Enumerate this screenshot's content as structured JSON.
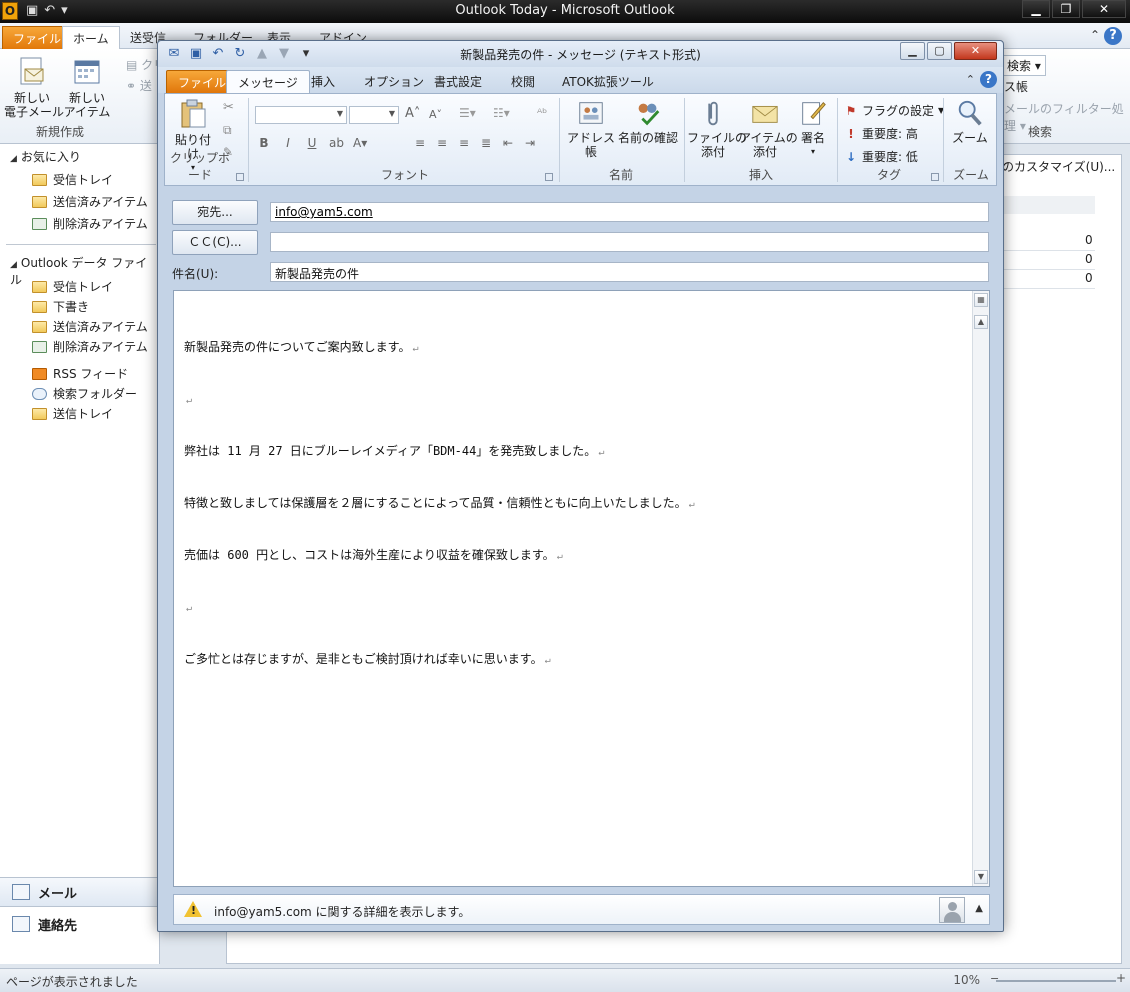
{
  "outlook": {
    "title": "Outlook Today - Microsoft Outlook",
    "app_icon_letter": "O",
    "tabs": [
      "ファイル",
      "ホーム",
      "送受信",
      "フォルダー",
      "表示",
      "アドイン"
    ],
    "ribbon": {
      "new_mail": "新しい\n電子メール",
      "new_items": "新しい\nアイテム",
      "group_new": "新規作成",
      "search_box": "検索",
      "address_book": "ス帳",
      "filter_mail": "メールのフィルター処理",
      "group_search": "検索"
    },
    "nav": {
      "favorites_header": "お気に入り",
      "favorites": [
        "受信トレイ",
        "送信済みアイテム",
        "削除済みアイテム"
      ],
      "data_file_header": "Outlook データ ファイル",
      "data_file_items": [
        "受信トレイ",
        "下書き",
        "送信済みアイテム",
        "削除済みアイテム",
        "RSS フィード",
        "検索フォルダー",
        "送信トレイ"
      ],
      "mail": "メール",
      "contacts": "連絡先"
    },
    "content": {
      "customize_link": "のカスタマイズ(U)...",
      "counts": [
        "0",
        "0",
        "0"
      ]
    },
    "status": {
      "text": "ページが表示されました",
      "zoom": "10%"
    }
  },
  "message": {
    "title": "新製品発売の件 - メッセージ (テキスト形式)",
    "tabs": [
      "ファイル",
      "メッセージ",
      "挿入",
      "オプション",
      "書式設定",
      "校閲",
      "ATOK拡張ツール"
    ],
    "ribbon": {
      "paste": "貼り付け",
      "group_clipboard": "クリップボード",
      "group_font": "フォント",
      "address_book": "アドレス帳",
      "check_names": "名前の確認",
      "group_names": "名前",
      "attach_file": "ファイルの\n添付",
      "attach_item": "アイテムの\n添付",
      "signature": "署名",
      "group_include": "挿入",
      "follow_up": "フラグの設定",
      "high_importance": "重要度: 高",
      "low_importance": "重要度: 低",
      "group_tags": "タグ",
      "zoom": "ズーム",
      "group_zoom": "ズーム"
    },
    "to_button": "宛先...",
    "cc_button": "ＣＣ(C)...",
    "subject_label": "件名(U):",
    "to_value": "info@yam5.com",
    "cc_value": "",
    "subject_value": "新製品発売の件",
    "body_lines": [
      "新製品発売の件についてご案内致します。",
      "",
      "弊社は 11 月 27 日にブルーレイメディア「BDM-44」を発売致しました。",
      "特徴と致しましては保護層を２層にすることによって品質・信頼性ともに向上いたしました。",
      "売価は 600 円とし、コストは海外生産により収益を確保致します。",
      "",
      "ご多忙とは存じますが、是非ともご検討頂ければ幸いに思います。"
    ],
    "info_bar": "info@yam5.com に関する詳細を表示します。"
  }
}
